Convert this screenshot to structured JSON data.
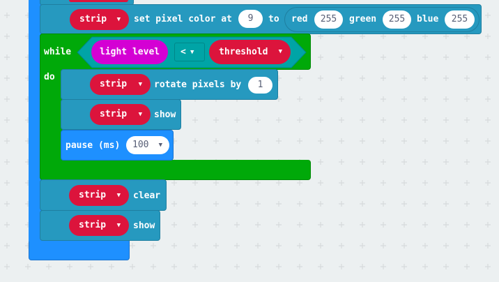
{
  "colors": {
    "background": "#ecf0f1",
    "grid_mark": "#d6dadc",
    "basic_blue": "#1e90ff",
    "neopixel_teal": "#2699bf",
    "loops_green": "#00a909",
    "input_magenta": "#d400d4",
    "dropdown_red": "#dc143c",
    "logic_teal": "#00a4a6"
  },
  "blocks": {
    "set_pixel": {
      "strip": "strip",
      "label": "set pixel color at",
      "index": "9",
      "to": "to",
      "red_label": "red",
      "red_value": "255",
      "green_label": "green",
      "green_value": "255",
      "blue_label": "blue",
      "blue_value": "255"
    },
    "while": {
      "while_label": "while",
      "do_label": "do",
      "sensor": "light level",
      "operator": "<",
      "variable": "threshold"
    },
    "rotate": {
      "strip": "strip",
      "label": "rotate pixels by",
      "value": "1"
    },
    "show1": {
      "strip": "strip",
      "label": "show"
    },
    "pause": {
      "label": "pause (ms)",
      "value": "100"
    },
    "clear": {
      "strip": "strip",
      "label": "clear"
    },
    "show2": {
      "strip": "strip",
      "label": "show"
    }
  },
  "icons": {
    "dropdown": "chevron-down-icon"
  }
}
